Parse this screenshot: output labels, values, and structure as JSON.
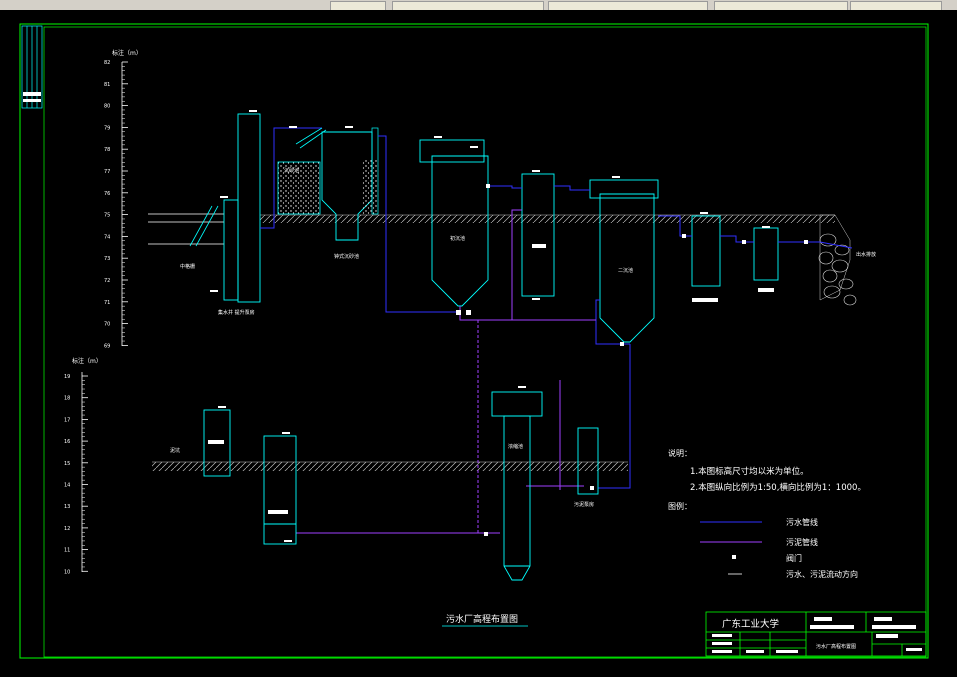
{
  "upper_scale": {
    "label": "标注（m）",
    "ticks": [
      "82",
      "81",
      "80",
      "79",
      "78",
      "77",
      "76",
      "75",
      "74",
      "73",
      "72",
      "71",
      "70",
      "69"
    ]
  },
  "lower_scale": {
    "label": "标注（m）",
    "ticks": [
      "19",
      "18",
      "17",
      "16",
      "15",
      "14",
      "13",
      "12",
      "11",
      "10"
    ]
  },
  "units": {
    "grid_chamber": "中格栅",
    "pump": "集水井  提升泵房",
    "settling_tank_1": "沉砂池",
    "aeration_grit": "钟式沉砂池",
    "primary_clarifier": "初沉池",
    "secondary_clarifier": "二沉池",
    "outfall": "出水排放",
    "concentrator": "浓缩池",
    "sludge_pump": "污泥泵房",
    "sludge_bed": "泥坑"
  },
  "notes": {
    "heading": "说明：",
    "line1": "1.本图标高尺寸均以米为单位。",
    "line2": "2.本图纵向比例为1:50,横向比例为1：1000。"
  },
  "legend": {
    "heading": "图例：",
    "items": [
      {
        "label": "污水管线",
        "color": "#3030ff"
      },
      {
        "label": "污泥管线",
        "color": "#a040ff"
      },
      {
        "label": "阀门",
        "color": "#ffffff"
      },
      {
        "label": "污水、污泥流动方向",
        "color": "#ffffff"
      }
    ]
  },
  "drawing_title": "污水厂高程布置图",
  "title_block": {
    "school": "广东工业大学",
    "drawing_name": "污水厂高程布置图"
  },
  "colors": {
    "frame": "#00ff00",
    "structure": "#00ffff",
    "sewage": "#3030ff",
    "sludge": "#a040ff",
    "text": "#ffffff",
    "title_box": "#00ff00"
  }
}
